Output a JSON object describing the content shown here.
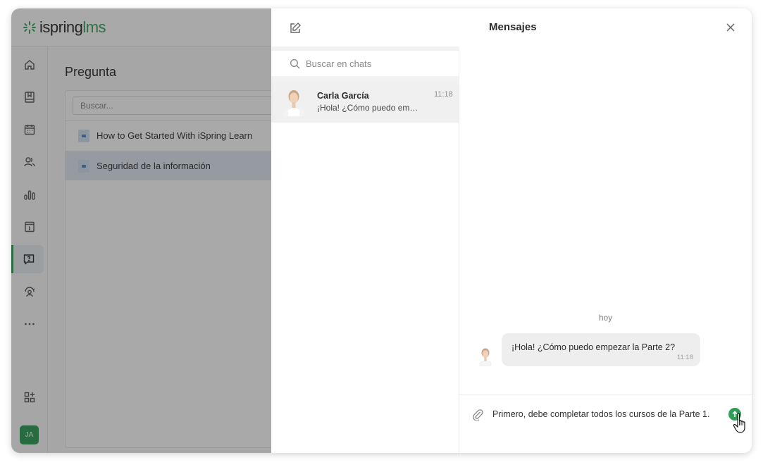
{
  "app": {
    "logo_text_main": "ispring",
    "logo_text_accent": "lms",
    "user_initials": "JA"
  },
  "main": {
    "title": "Pregunta",
    "search_placeholder": "Buscar...",
    "documents": [
      {
        "title": "How to Get Started With iSpring Learn"
      },
      {
        "title": "Seguridad de la información"
      }
    ]
  },
  "messages": {
    "title": "Mensajes",
    "search_placeholder": "Buscar en chats",
    "chats": [
      {
        "name": "Carla García",
        "time": "11:18",
        "preview": "¡Hola! ¿Cómo puedo empezar la Parte 2?"
      }
    ],
    "conversation": {
      "day_label": "hoy",
      "messages": [
        {
          "text": "¡Hola! ¿Cómo puedo empezar la Parte 2?",
          "time": "11:18"
        }
      ],
      "draft": "Primero, debe completar todos los cursos de la Parte 1."
    }
  },
  "colors": {
    "accent": "#2f9c57",
    "selected_row": "#dfe9f3"
  },
  "icons": [
    "home-icon",
    "book-icon",
    "calendar-icon",
    "users-icon",
    "reports-icon",
    "info-icon",
    "question-icon",
    "support-icon",
    "more-icon",
    "apps-icon",
    "compose-icon",
    "close-icon",
    "search-icon",
    "attach-icon",
    "send-icon",
    "cursor-icon"
  ]
}
